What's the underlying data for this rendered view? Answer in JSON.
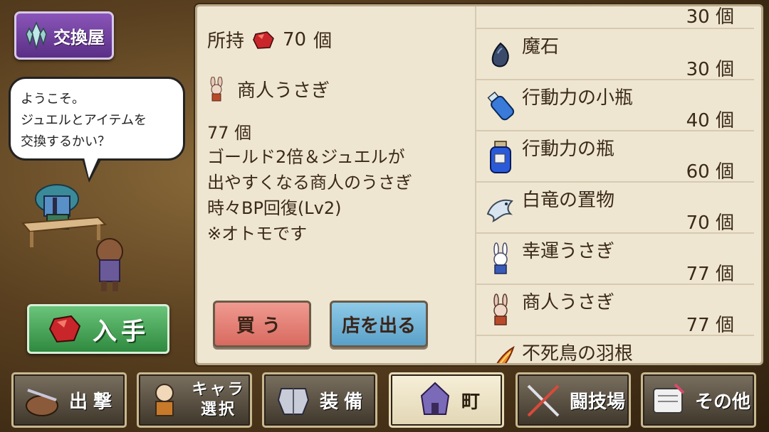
{
  "shop": {
    "title": "交換屋"
  },
  "npc": {
    "speech": "ようこそ。\nジュエルとアイテムを\n交換するかい？"
  },
  "obtain_button": {
    "label": "入手"
  },
  "owned": {
    "label": "所持",
    "value": "70",
    "unit": "個"
  },
  "selected": {
    "name": "商人うさぎ",
    "count": "77 個",
    "description": "ゴールド2倍＆ジュエルが\n出やすくなる商人のうさぎ\n時々BP回復(Lv2)\n※オトモです"
  },
  "actions": {
    "buy": "買う",
    "leave": "店を出る"
  },
  "items": [
    {
      "name": "",
      "price": "30 個",
      "icon": "partial-item"
    },
    {
      "name": "魔石",
      "price": "30 個",
      "icon": "magic-stone-icon"
    },
    {
      "name": "行動力の小瓶",
      "price": "40 個",
      "icon": "small-bottle-icon"
    },
    {
      "name": "行動力の瓶",
      "price": "60 個",
      "icon": "bottle-icon"
    },
    {
      "name": "白竜の置物",
      "price": "70 個",
      "icon": "white-dragon-icon"
    },
    {
      "name": "幸運うさぎ",
      "price": "77 個",
      "icon": "lucky-rabbit-icon"
    },
    {
      "name": "商人うさぎ",
      "price": "77 個",
      "icon": "merchant-rabbit-icon"
    },
    {
      "name": "不死鳥の羽根",
      "price": "",
      "icon": "phoenix-feather-icon"
    }
  ],
  "nav": {
    "sortie": "出撃",
    "chara_line1": "キャラ",
    "chara_line2": "選択",
    "equip": "装備",
    "town": "町",
    "arena": "闘技場",
    "other": "その他"
  },
  "colors": {
    "accent_purple": "#6a3a98",
    "obtain_green": "#3f9a4f",
    "buy_red": "#e07a70",
    "leave_blue": "#6aaed6",
    "panel_bg": "#efe6d2"
  }
}
